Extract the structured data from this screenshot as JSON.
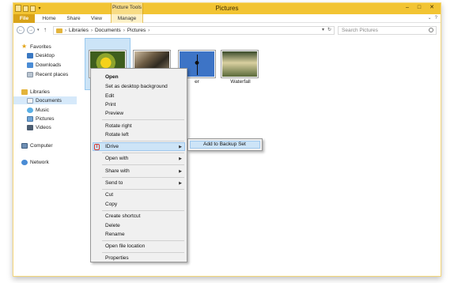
{
  "window": {
    "title": "Pictures",
    "context_tab_group": "Picture Tools",
    "controls": {
      "minimize": "–",
      "maximize": "□",
      "close": "✕"
    }
  },
  "ribbon": {
    "tabs": [
      {
        "label": "File"
      },
      {
        "label": "Home"
      },
      {
        "label": "Share"
      },
      {
        "label": "View"
      },
      {
        "label": "Manage"
      }
    ],
    "expand": "⌄",
    "help": "?"
  },
  "address": {
    "back": "←",
    "forward": "→",
    "dropdown": "▾",
    "up": "↑",
    "path": [
      "Libraries",
      "Documents",
      "Pictures"
    ],
    "separator": "›",
    "history_dropdown": "▾",
    "refresh": "↻"
  },
  "search": {
    "placeholder": "Search Pictures"
  },
  "nav_pane": {
    "favorites": {
      "label": "Favorites",
      "items": [
        "Desktop",
        "Downloads",
        "Recent places"
      ]
    },
    "libraries": {
      "label": "Libraries",
      "items": [
        "Documents",
        "Music",
        "Pictures",
        "Videos"
      ],
      "selected": "Documents"
    },
    "computer": "Computer",
    "network": "Network"
  },
  "files": [
    {
      "name": "F",
      "subject": "yellow flower"
    },
    {
      "name": "",
      "subject": "bird"
    },
    {
      "name": "er",
      "subject": "spider"
    },
    {
      "name": "Waterfall",
      "subject": "waterfall"
    }
  ],
  "context_menu": {
    "items": {
      "open": "Open",
      "set_desktop_background": "Set as desktop background",
      "edit": "Edit",
      "print": "Print",
      "preview": "Preview",
      "rotate_right": "Rotate right",
      "rotate_left": "Rotate left",
      "idrive": "IDrive",
      "open_with": "Open with",
      "share_with": "Share with",
      "send_to": "Send to",
      "cut": "Cut",
      "copy": "Copy",
      "create_shortcut": "Create shortcut",
      "delete": "Delete",
      "rename": "Rename",
      "open_file_location": "Open file location",
      "properties": "Properties"
    },
    "submenu_arrow": "▶",
    "idrive_glyph": "I",
    "highlighted": "IDrive"
  },
  "submenu": {
    "add_to_backup_set": "Add to Backup Set"
  },
  "colors": {
    "titlebar": "#f2c433",
    "file_tab": "#d9a319",
    "highlight": "#cde4f7",
    "selection": "#cce4f7"
  }
}
